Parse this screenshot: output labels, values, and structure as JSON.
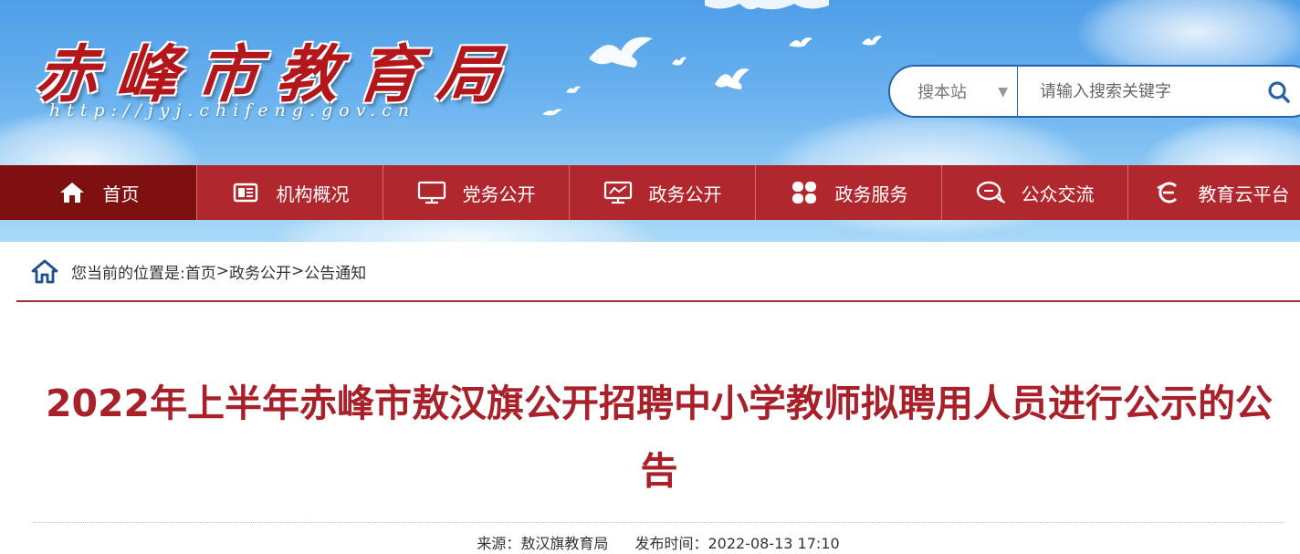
{
  "header": {
    "site_title": "赤峰市教育局",
    "site_url": "http://jyj.chifeng.gov.cn"
  },
  "search": {
    "scope": "搜本站",
    "placeholder": "请输入搜索关键字",
    "icon": "search-icon"
  },
  "nav": {
    "items": [
      {
        "label": "首页",
        "icon": "home-icon"
      },
      {
        "label": "机构概况",
        "icon": "newspaper-icon"
      },
      {
        "label": "党务公开",
        "icon": "monitor-icon"
      },
      {
        "label": "政务公开",
        "icon": "presentation-icon"
      },
      {
        "label": "政务服务",
        "icon": "grid-icon"
      },
      {
        "label": "公众交流",
        "icon": "chat-icon"
      },
      {
        "label": "教育云平台",
        "icon": "cloud-e-icon"
      }
    ]
  },
  "breadcrumb": {
    "label": "您当前的位置是:",
    "items": [
      "首页",
      "政务公开",
      "公告通知"
    ],
    "separator": ">"
  },
  "article": {
    "title": "2022年上半年赤峰市敖汉旗公开招聘中小学教师拟聘用人员进行公示的公告",
    "source": "来源：敖汉旗教育局",
    "published": "发布时间：2022-08-13 17:10"
  },
  "colors": {
    "nav_bg": "#b0282e",
    "nav_active": "#7e1012",
    "title": "#a8212a",
    "search_border": "#2a64a8"
  }
}
